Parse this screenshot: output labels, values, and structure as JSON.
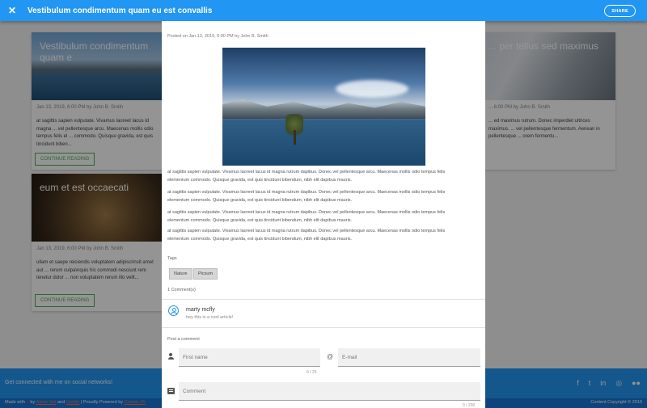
{
  "appbar": {
    "title": "Vestibulum condimentum quam eu est convallis",
    "share_label": "SHARE",
    "close_icon": "close-icon"
  },
  "background": {
    "cards": [
      {
        "title": "Vestibulum condimentum quam e",
        "meta": "Jan 13, 2019, 6:00 PM by John B. Smith",
        "excerpt": "at sagittis sapien vulputate. Vivamus laoreet lacus id magna ... vel pellentesque arcu. Maecenas mollis odio tempus felis el ... commodo. Quisque gravida, est quis tincidunt biben...",
        "button": "CONTINUE READING"
      },
      {
        "title": "eum et est occaecati",
        "meta": "Jan 13, 2019, 6:00 PM by John B. Smith",
        "excerpt": "ullam et saepe reiciendis voluptatem adipisci\\nsit amet aut ... rerum culpa\\nquis hic commodi nesciunt rem tenetur dolor ... non voluptatem rerum illo velit...",
        "button": "CONTINUE READING"
      },
      {
        "title": "... per tellus sed maximus",
        "meta": "... 6:00 PM by John B. Smith",
        "excerpt": "... ed maximus rutrum. Donec imperdiet ultrices maximus. ... vel pellentesque fermentum. Aenean in pellentesque ... orem fermentu..."
      }
    ],
    "footer": {
      "social_label": "Get connected with me on social networks!",
      "made_prefix": "Made with",
      "made_by": "by",
      "author_link": "Aaron Vail",
      "and_text": "and",
      "vuetify_link": "Vuetify",
      "powered": "| Proudly Powered by",
      "cosmic_link": "Cosmic JS",
      "copyright": "Content Copyright © 2019",
      "icons": [
        "facebook-icon",
        "twitter-icon",
        "linkedin-icon",
        "instagram-icon",
        "flickr-icon"
      ]
    }
  },
  "article": {
    "posted": "Posted on Jan 13, 2019, 6:00 PM by John B. Smith",
    "paragraphs": [
      "at sagittis sapien vulputate. Vivamus laoreet lacus id magna rutrum dapibus. Donec vel pellentesque arcu. Maecenas mollis odio tempus felis elementum commodo. Quisque gravida, est quis tincidunt bibendum, nibh elit dapibus mauris.",
      "at sagittis sapien vulputate. Vivamus laoreet lacus id magna rutrum dapibus. Donec vel pellentesque arcu. Maecenas mollis odio tempus felis elementum commodo. Quisque gravida, est quis tincidunt bibendum, nibh elit dapibus mauris.",
      "at sagittis sapien vulputate. Vivamus laoreet lacus id magna rutrum dapibus. Donec vel pellentesque arcu. Maecenas mollis odio tempus felis elementum commodo. Quisque gravida, est quis tincidunt bibendum, nibh elit dapibus mauris.",
      "at sagittis sapien vulputate. Vivamus laoreet lacus id magna rutrum dapibus. Donec vel pellentesque arcu. Maecenas mollis odio tempus felis elementum commodo. Quisque gravida, est quis tincidunt bibendum, nibh elit dapibus mauris."
    ],
    "tags_label": "Tags",
    "tags": [
      "Nature",
      "Picsum"
    ],
    "comments_count": "1 Comment(s)",
    "comments": [
      {
        "author": "marty mcfly",
        "text": "hey this is a cool article!"
      }
    ],
    "form": {
      "label": "Post a comment",
      "first_name_placeholder": "First name",
      "first_name_counter": "0 / 25",
      "email_placeholder": "E-mail",
      "comment_placeholder": "Comment",
      "comment_counter": "0 / 200"
    }
  },
  "colors": {
    "primary": "#2196f3",
    "primary_dark": "#1976d2",
    "accent_green": "#4caf50"
  }
}
